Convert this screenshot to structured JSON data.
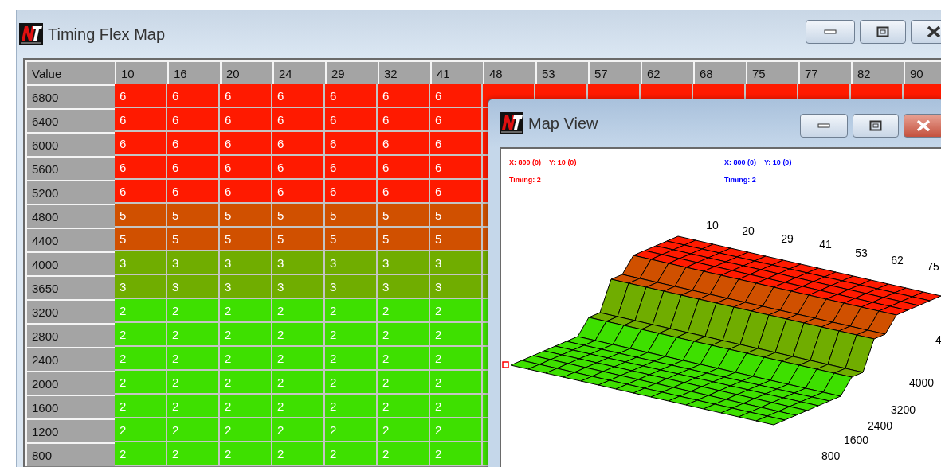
{
  "main_window": {
    "title": "Timing Flex Map"
  },
  "table": {
    "corner": "Value",
    "columns": [
      "10",
      "16",
      "20",
      "24",
      "29",
      "32",
      "41",
      "48",
      "53",
      "57",
      "62",
      "68",
      "75",
      "77",
      "82",
      "90"
    ],
    "rows": [
      {
        "label": "6800",
        "color": "#ff1a00",
        "cells": [
          "6",
          "6",
          "6",
          "6",
          "6",
          "6",
          "6"
        ]
      },
      {
        "label": "6400",
        "color": "#ff1a00",
        "cells": [
          "6",
          "6",
          "6",
          "6",
          "6",
          "6",
          "6"
        ]
      },
      {
        "label": "6000",
        "color": "#ff1a00",
        "cells": [
          "6",
          "6",
          "6",
          "6",
          "6",
          "6",
          "6"
        ]
      },
      {
        "label": "5600",
        "color": "#ff1a00",
        "cells": [
          "6",
          "6",
          "6",
          "6",
          "6",
          "6",
          "6"
        ]
      },
      {
        "label": "5200",
        "color": "#ff1a00",
        "cells": [
          "6",
          "6",
          "6",
          "6",
          "6",
          "6",
          "6"
        ]
      },
      {
        "label": "4800",
        "color": "#d05000",
        "cells": [
          "5",
          "5",
          "5",
          "5",
          "5",
          "5",
          "5"
        ]
      },
      {
        "label": "4400",
        "color": "#d05000",
        "cells": [
          "5",
          "5",
          "5",
          "5",
          "5",
          "5",
          "5"
        ]
      },
      {
        "label": "4000",
        "color": "#70ad00",
        "cells": [
          "3",
          "3",
          "3",
          "3",
          "3",
          "3",
          "3"
        ]
      },
      {
        "label": "3650",
        "color": "#70ad00",
        "cells": [
          "3",
          "3",
          "3",
          "3",
          "3",
          "3",
          "3"
        ]
      },
      {
        "label": "3200",
        "color": "#3ee000",
        "cells": [
          "2",
          "2",
          "2",
          "2",
          "2",
          "2",
          "2"
        ]
      },
      {
        "label": "2800",
        "color": "#3ee000",
        "cells": [
          "2",
          "2",
          "2",
          "2",
          "2",
          "2",
          "2"
        ]
      },
      {
        "label": "2400",
        "color": "#3ee000",
        "cells": [
          "2",
          "2",
          "2",
          "2",
          "2",
          "2",
          "2"
        ]
      },
      {
        "label": "2000",
        "color": "#3ee000",
        "cells": [
          "2",
          "2",
          "2",
          "2",
          "2",
          "2",
          "2"
        ]
      },
      {
        "label": "1600",
        "color": "#3ee000",
        "cells": [
          "2",
          "2",
          "2",
          "2",
          "2",
          "2",
          "2"
        ]
      },
      {
        "label": "1200",
        "color": "#3ee000",
        "cells": [
          "2",
          "2",
          "2",
          "2",
          "2",
          "2",
          "2"
        ]
      },
      {
        "label": "800",
        "color": "#3ee000",
        "cells": [
          "2",
          "2",
          "2",
          "2",
          "2",
          "2",
          "2"
        ]
      }
    ]
  },
  "map_view": {
    "title": "Map View",
    "readouts": [
      {
        "x": "X: 800 (0)",
        "y": "Y: 10 (0)",
        "timing": "Timing: 2",
        "color": "#ff0000"
      },
      {
        "x": "X: 800 (0)",
        "y": "Y: 10 (0)",
        "timing": "Timing: 2",
        "color": "#0000ff"
      }
    ],
    "x_labels": [
      "10",
      "20",
      "29",
      "41",
      "53",
      "62",
      "75"
    ],
    "y_labels": [
      "800",
      "1600",
      "2400",
      "3200",
      "4000",
      "4"
    ]
  }
}
